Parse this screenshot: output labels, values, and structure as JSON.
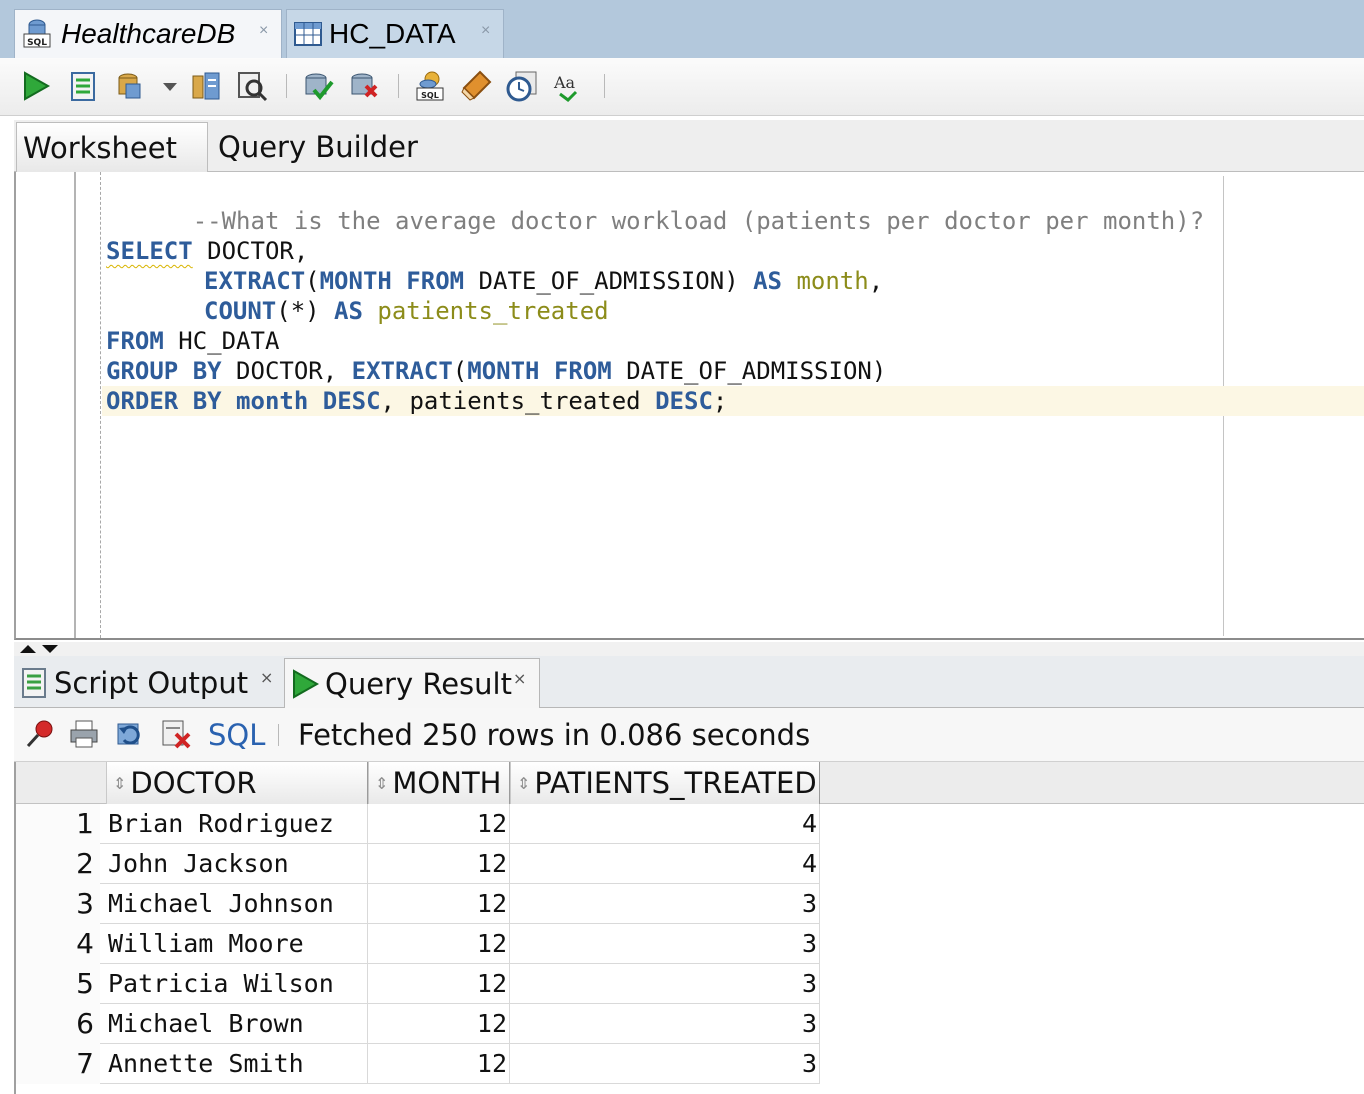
{
  "doc_tabs": [
    {
      "label": "HealthcareDB",
      "icon": "sql-worksheet-icon",
      "close": "×"
    },
    {
      "label": "HC_DATA",
      "icon": "table-icon",
      "close": "×"
    }
  ],
  "worksheet_tabs": [
    {
      "label": "Worksheet"
    },
    {
      "label": "Query Builder"
    }
  ],
  "editor": {
    "comment": "--What is the average doctor workload (patients per doctor per month)?",
    "l1": {
      "kw": "SELECT",
      "rest": " DOCTOR,"
    },
    "l2": {
      "kw1": "EXTRACT",
      "p1": "(",
      "kw2": "MONTH FROM",
      "p2": " DATE_OF_ADMISSION) ",
      "kw3": "AS",
      "sp": " ",
      "alias": "month",
      "p3": ","
    },
    "l3": {
      "kw1": "COUNT",
      "p1": "(*) ",
      "kw2": "AS",
      "sp": " ",
      "alias": "patients_treated"
    },
    "l4": {
      "kw": "FROM",
      "rest": " HC_DATA"
    },
    "l5": {
      "kw1": "GROUP BY",
      "p1": " DOCTOR, ",
      "kw2": "EXTRACT",
      "p2": "(",
      "kw3": "MONTH FROM",
      "p3": " DATE_OF_ADMISSION)"
    },
    "l6": {
      "kw1": "ORDER BY",
      "sp": " ",
      "kw2": "month DESC",
      "p1": ", patients_treated ",
      "kw3": "DESC",
      "p2": ";"
    }
  },
  "result_tabs": [
    {
      "label": "Script Output",
      "close": "×"
    },
    {
      "label": "Query Result",
      "close": "×"
    }
  ],
  "result_toolbar": {
    "sql_label": "SQL",
    "status": "Fetched 250 rows in 0.086 seconds"
  },
  "grid": {
    "columns": [
      "DOCTOR",
      "MONTH",
      "PATIENTS_TREATED"
    ],
    "rows": [
      {
        "n": "1",
        "doctor": "Brian Rodriguez",
        "month": "12",
        "patients": "4"
      },
      {
        "n": "2",
        "doctor": "John Jackson",
        "month": "12",
        "patients": "4"
      },
      {
        "n": "3",
        "doctor": "Michael Johnson",
        "month": "12",
        "patients": "3"
      },
      {
        "n": "4",
        "doctor": "William Moore",
        "month": "12",
        "patients": "3"
      },
      {
        "n": "5",
        "doctor": "Patricia Wilson",
        "month": "12",
        "patients": "3"
      },
      {
        "n": "6",
        "doctor": "Michael Brown",
        "month": "12",
        "patients": "3"
      },
      {
        "n": "7",
        "doctor": "Annette Smith",
        "month": "12",
        "patients": "3"
      }
    ]
  },
  "colors": {
    "keyword": "#2e5c9a",
    "alias": "#8c8c1a",
    "comment": "#7f7f7f",
    "link": "#2a62b0",
    "tab_bar": "#b3c8dc"
  }
}
